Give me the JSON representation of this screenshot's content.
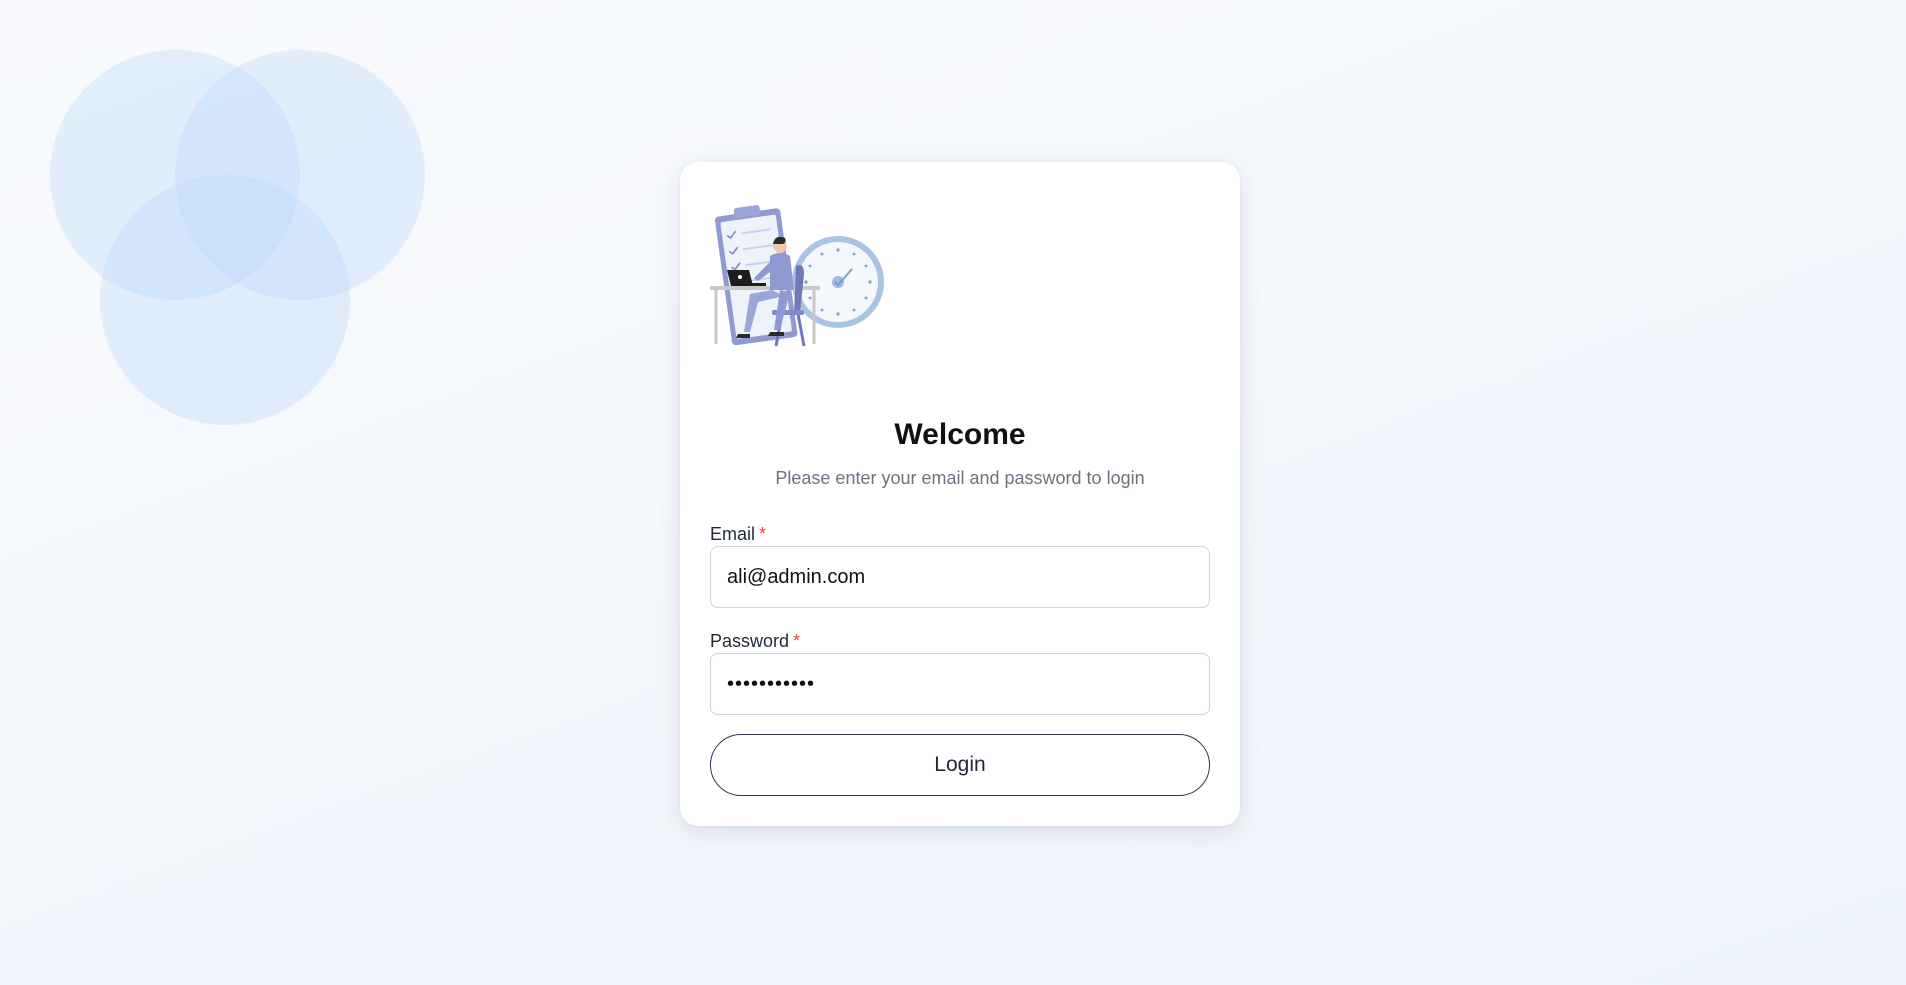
{
  "colors": {
    "accent": "#2b3150",
    "required": "#ef4444",
    "decor_circle": "#bad6fa"
  },
  "illustration": {
    "icon": "person-at-laptop-checklist-clock-illustration"
  },
  "login": {
    "title": "Welcome",
    "subtitle": "Please enter your email and password to login",
    "email": {
      "label": "Email",
      "required_mark": "*",
      "value": "ali@admin.com"
    },
    "password": {
      "label": "Password",
      "required_mark": "*",
      "value": "***********"
    },
    "submit_label": "Login"
  }
}
